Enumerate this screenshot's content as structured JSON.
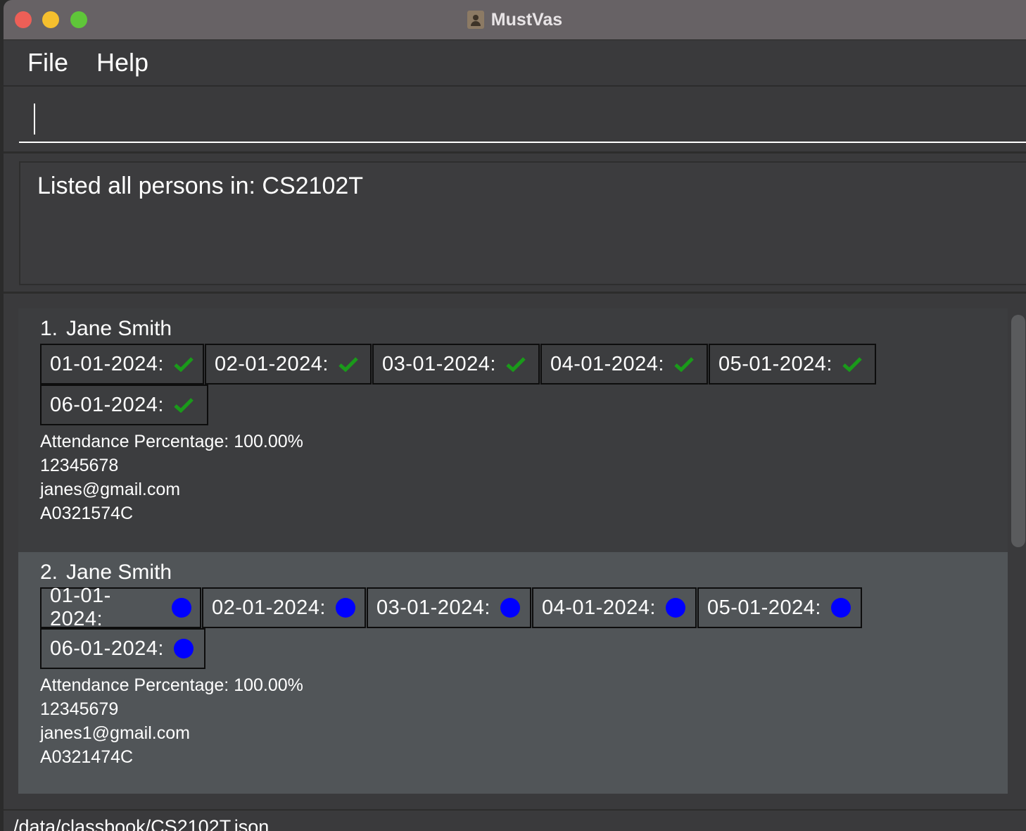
{
  "window": {
    "title": "MustVas"
  },
  "menu": {
    "file": "File",
    "help": "Help"
  },
  "command": {
    "value": ""
  },
  "result": {
    "message": "Listed all persons in: CS2102T"
  },
  "persons": [
    {
      "index": "1.",
      "name": "Jane Smith",
      "attendance": [
        {
          "date": "01-01-2024:",
          "status": "check"
        },
        {
          "date": "02-01-2024:",
          "status": "check"
        },
        {
          "date": "03-01-2024:",
          "status": "check"
        },
        {
          "date": "04-01-2024:",
          "status": "check"
        },
        {
          "date": "05-01-2024:",
          "status": "check"
        },
        {
          "date": "06-01-2024:",
          "status": "check"
        }
      ],
      "percentage": "Attendance Percentage: 100.00%",
      "phone": "12345678",
      "email": "janes@gmail.com",
      "student_id": "A0321574C"
    },
    {
      "index": "2.",
      "name": "Jane Smith",
      "attendance": [
        {
          "date": "01-01-2024:",
          "status": "dot"
        },
        {
          "date": "02-01-2024:",
          "status": "dot"
        },
        {
          "date": "03-01-2024:",
          "status": "dot"
        },
        {
          "date": "04-01-2024:",
          "status": "dot"
        },
        {
          "date": "05-01-2024:",
          "status": "dot"
        },
        {
          "date": "06-01-2024:",
          "status": "dot"
        }
      ],
      "percentage": "Attendance Percentage: 100.00%",
      "phone": "12345679",
      "email": "janes1@gmail.com",
      "student_id": "A0321474C"
    }
  ],
  "status_bar": {
    "path": "/data/classbook/CS2102T.json"
  },
  "colors": {
    "check": "#1a9a1a",
    "dot": "#0000ff"
  }
}
